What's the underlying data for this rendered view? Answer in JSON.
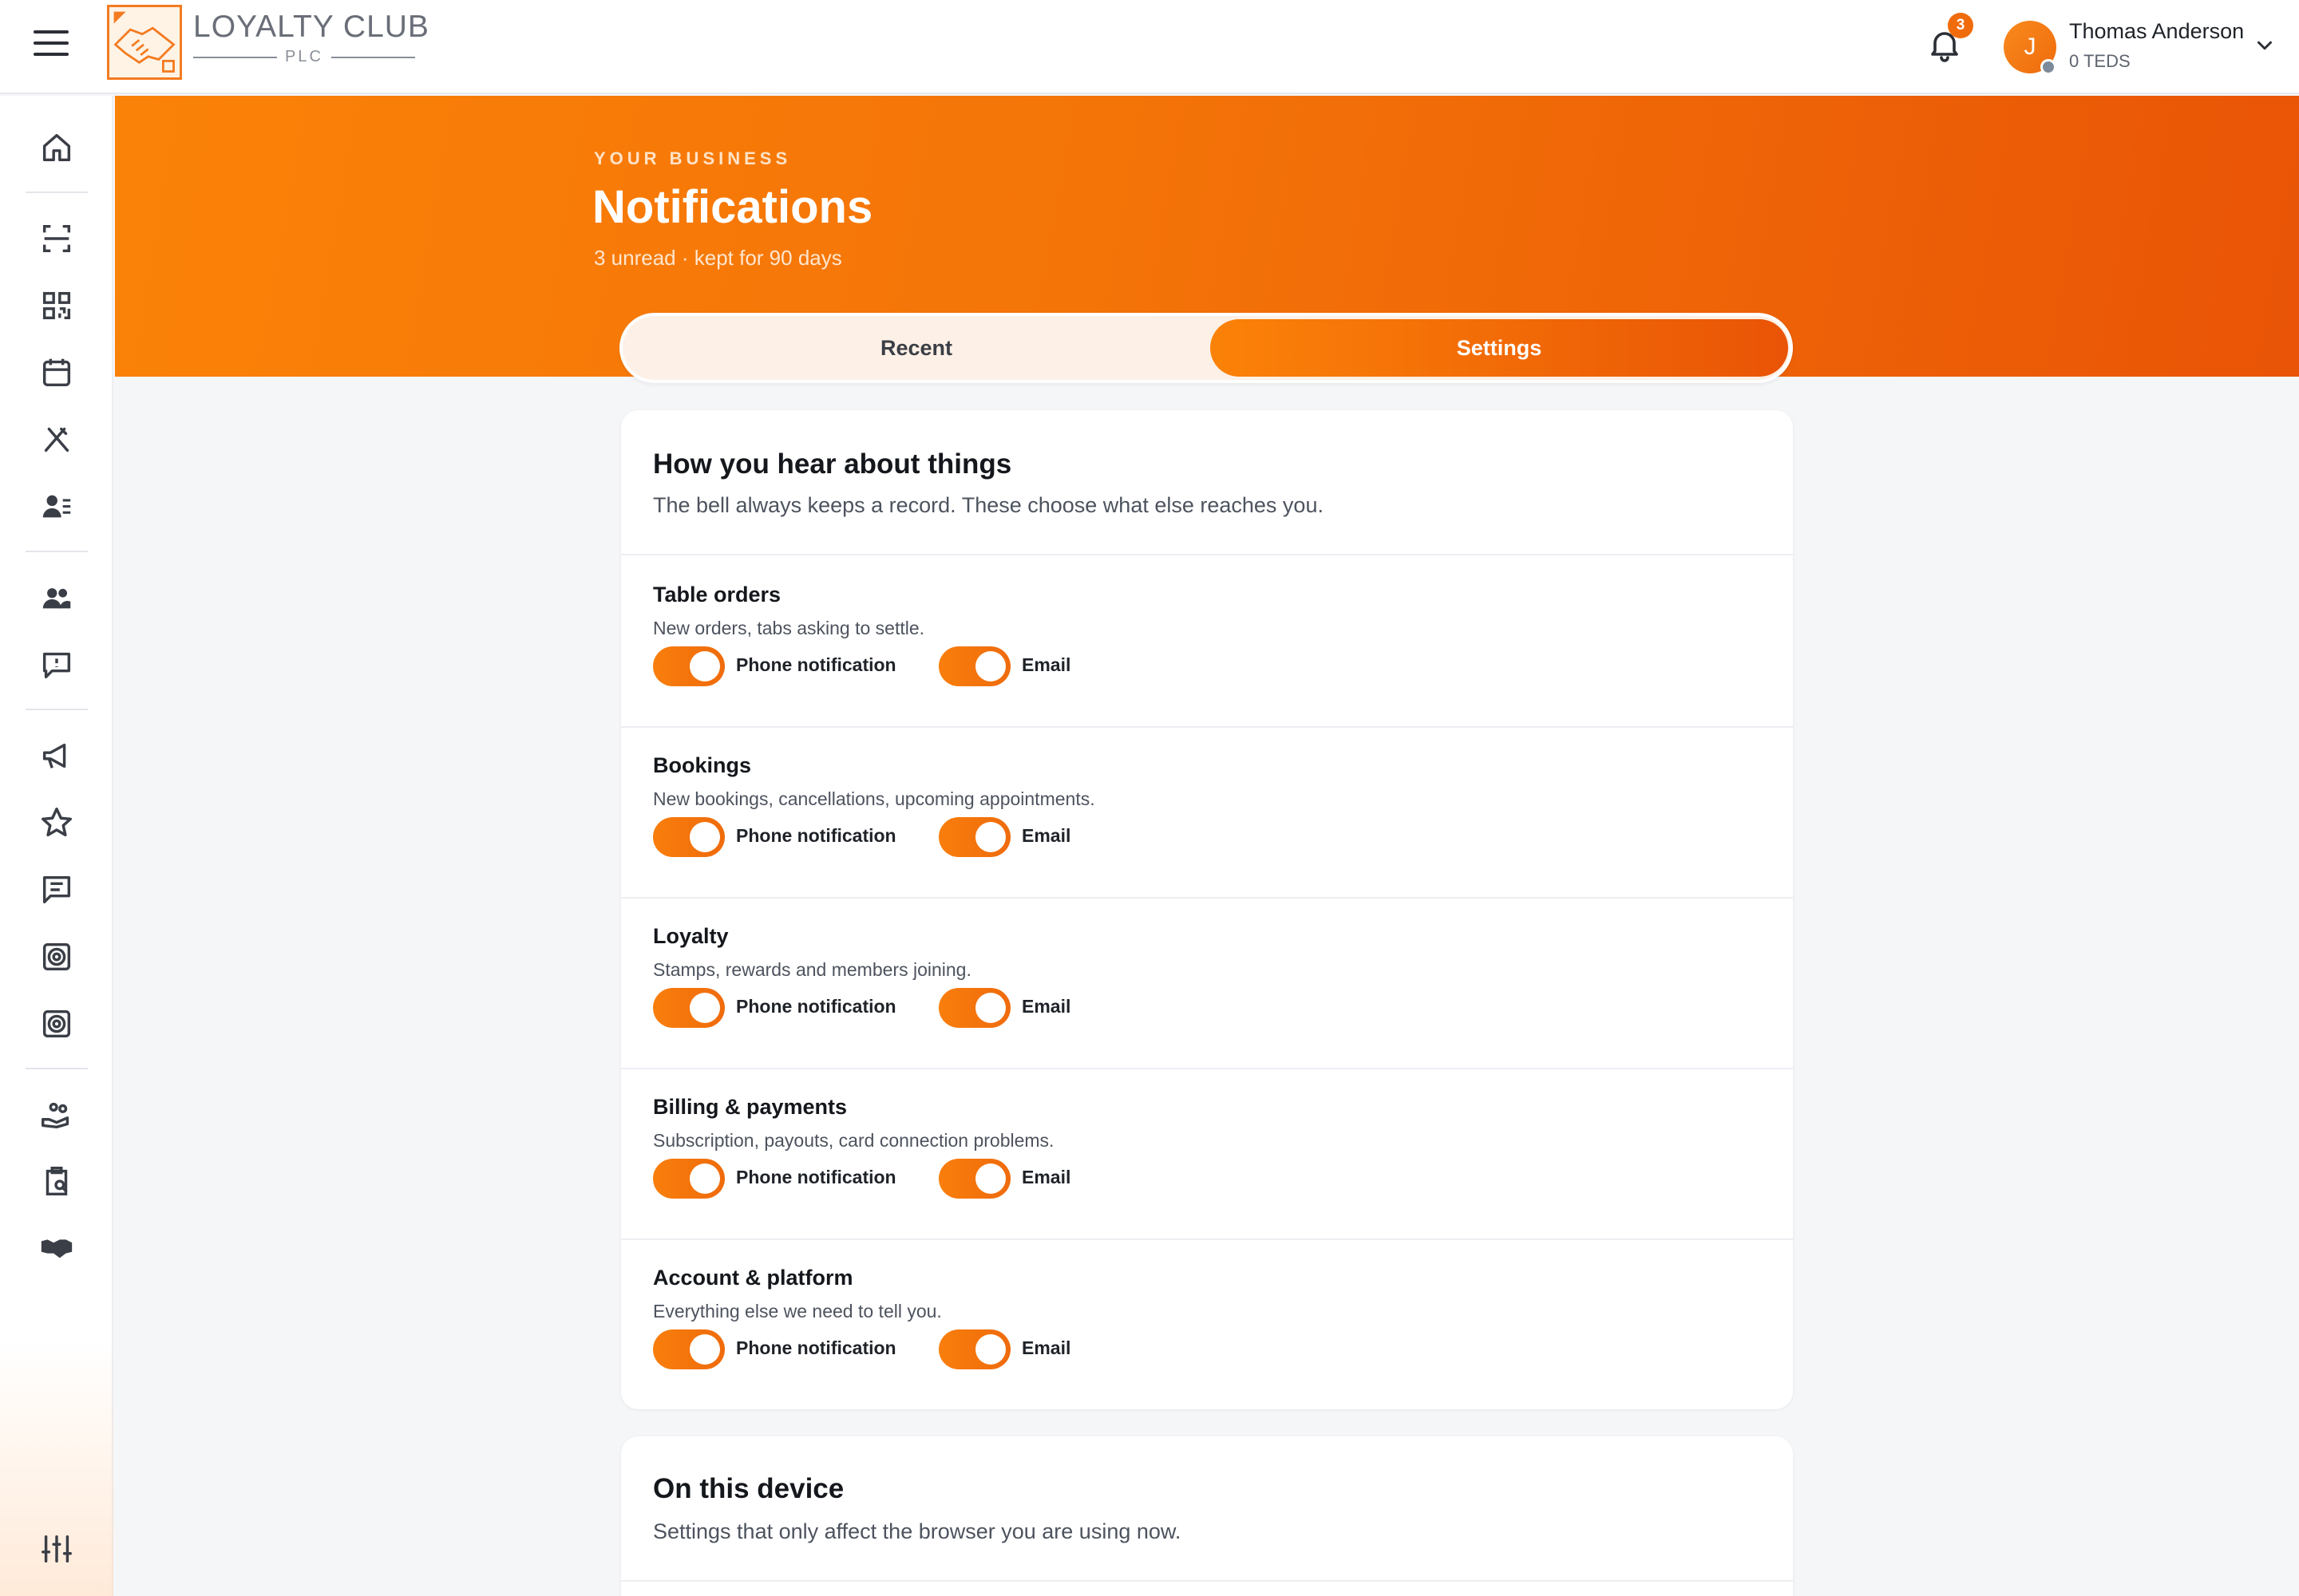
{
  "app": {
    "brand_name": "LOYALTY CLUB",
    "brand_suffix": "PLC",
    "brand_color": "#ef6b0c"
  },
  "header": {
    "notifications_count": "3",
    "user": {
      "initial": "J",
      "name": "Thomas Anderson",
      "sub": "0 TEDS"
    }
  },
  "sidebar": {
    "icons": [
      "home-icon",
      "scan-icon",
      "qr-code-icon",
      "calendar-icon",
      "utensils-icon",
      "staff-list-icon",
      "users-icon",
      "feedback-icon",
      "megaphone-icon",
      "star-icon",
      "messages-icon",
      "target-icon",
      "target-alt-icon",
      "hand-heart-icon",
      "clipboard-search-icon",
      "handshake-icon",
      "sliders-icon"
    ]
  },
  "hero": {
    "eyebrow": "YOUR BUSINESS",
    "title": "Notifications",
    "subtitle": "3 unread · kept for 90 days"
  },
  "tabs": [
    {
      "label": "Recent",
      "active": false
    },
    {
      "label": "Settings",
      "active": true
    }
  ],
  "channels_card": {
    "title": "How you hear about things",
    "description": "The bell always keeps a record. These choose what else reaches you.",
    "rows": [
      {
        "title": "Table orders",
        "description": "New orders, tabs asking to settle.",
        "phone_label": "Phone notification",
        "phone_on": true,
        "email_label": "Email",
        "email_on": true
      },
      {
        "title": "Bookings",
        "description": "New bookings, cancellations, upcoming appointments.",
        "phone_label": "Phone notification",
        "phone_on": true,
        "email_label": "Email",
        "email_on": true
      },
      {
        "title": "Loyalty",
        "description": "Stamps, rewards and members joining.",
        "phone_label": "Phone notification",
        "phone_on": true,
        "email_label": "Email",
        "email_on": true
      },
      {
        "title": "Billing & payments",
        "description": "Subscription, payouts, card connection problems.",
        "phone_label": "Phone notification",
        "phone_on": true,
        "email_label": "Email",
        "email_on": true
      },
      {
        "title": "Account & platform",
        "description": "Everything else we need to tell you.",
        "phone_label": "Phone notification",
        "phone_on": true,
        "email_label": "Email",
        "email_on": true
      }
    ]
  },
  "device_card": {
    "title": "On this device",
    "description": "Settings that only affect the browser you are using now."
  }
}
